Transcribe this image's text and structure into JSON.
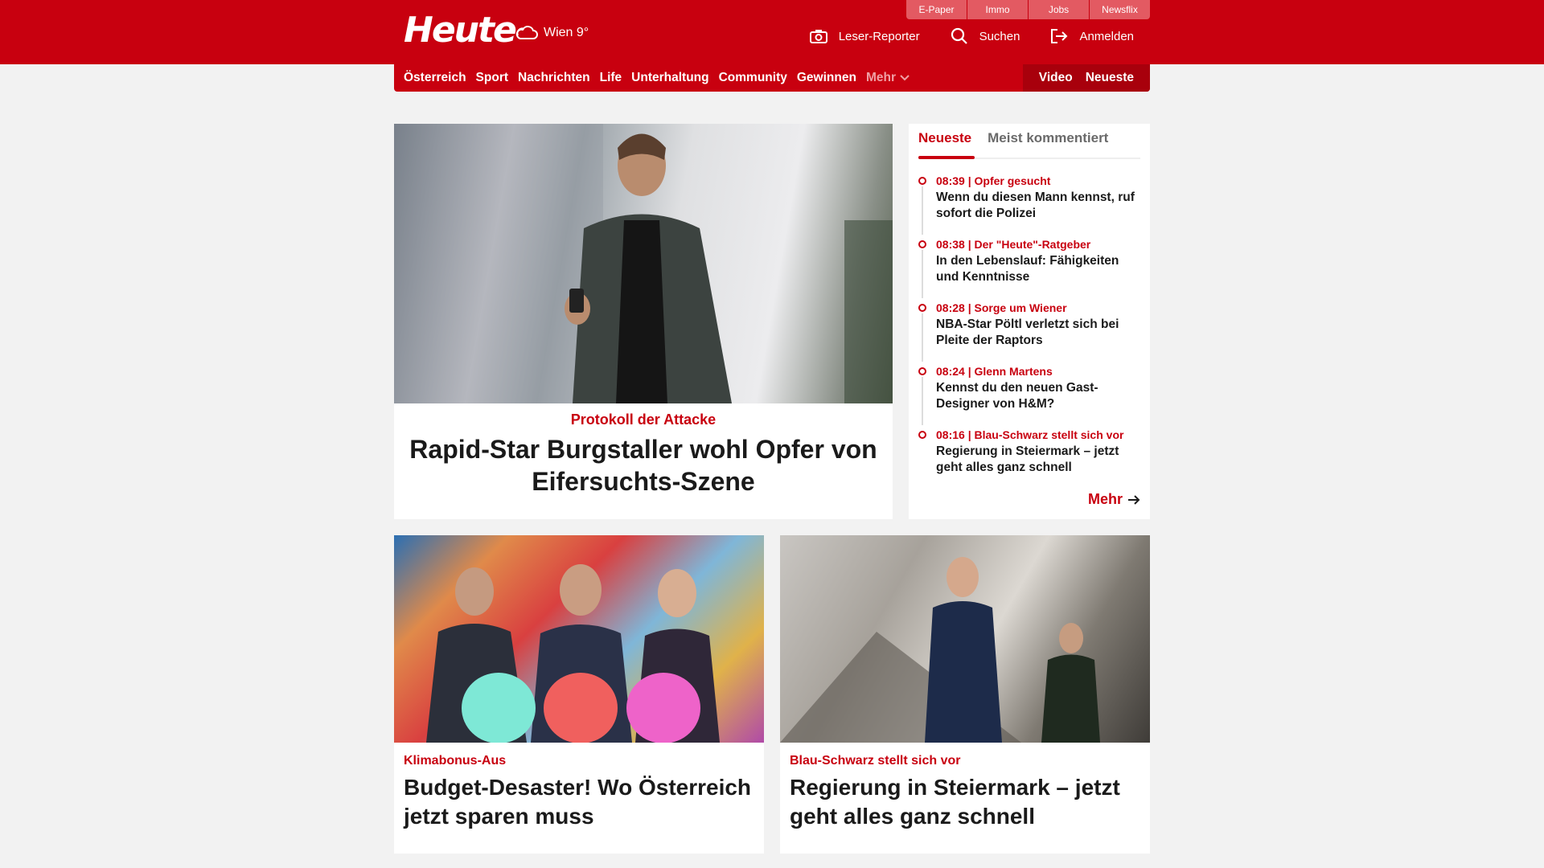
{
  "header": {
    "logo": "Heute",
    "weather": "Wien 9°",
    "service_tabs": [
      "E-Paper",
      "Immo",
      "Jobs",
      "Newsflix"
    ],
    "actions": {
      "reporter": "Leser-Reporter",
      "search": "Suchen",
      "login": "Anmelden"
    },
    "colors": {
      "brand": "#c8000f"
    }
  },
  "nav": {
    "items": [
      "Österreich",
      "Sport",
      "Nachrichten",
      "Life",
      "Unterhaltung",
      "Community",
      "Gewinnen"
    ],
    "more": "Mehr",
    "right": [
      "Video",
      "Neueste"
    ]
  },
  "hero": {
    "kicker": "Protokoll der Attacke",
    "title": "Rapid-Star Burgstaller wohl Opfer von Eifersuchts-Szene"
  },
  "sidebar": {
    "tabs": [
      "Neueste",
      "Meist kommentiert"
    ],
    "items": [
      {
        "meta": "08:39 | Opfer gesucht",
        "title": "Wenn du diesen Mann kennst, ruf sofort die Polizei"
      },
      {
        "meta": "08:38 | Der \"Heute\"-Ratgeber",
        "title": "In den Lebenslauf: Fähigkeiten und Kenntnisse"
      },
      {
        "meta": "08:28 | Sorge um Wiener",
        "title": "NBA-Star Pöltl verletzt sich bei Pleite der Raptors"
      },
      {
        "meta": "08:24 | Glenn Martens",
        "title": "Kennst du den neuen Gast-Designer von H&M?"
      },
      {
        "meta": "08:16 | Blau-Schwarz stellt sich vor",
        "title": "Regierung in Steiermark – jetzt geht alles ganz schnell"
      }
    ],
    "more": "Mehr"
  },
  "cards": [
    {
      "kicker": "Klimabonus-Aus",
      "title": "Budget-Desaster! Wo Österreich jetzt sparen muss"
    },
    {
      "kicker": "Blau-Schwarz stellt sich vor",
      "title": "Regierung in Steiermark – jetzt geht alles ganz schnell"
    }
  ]
}
